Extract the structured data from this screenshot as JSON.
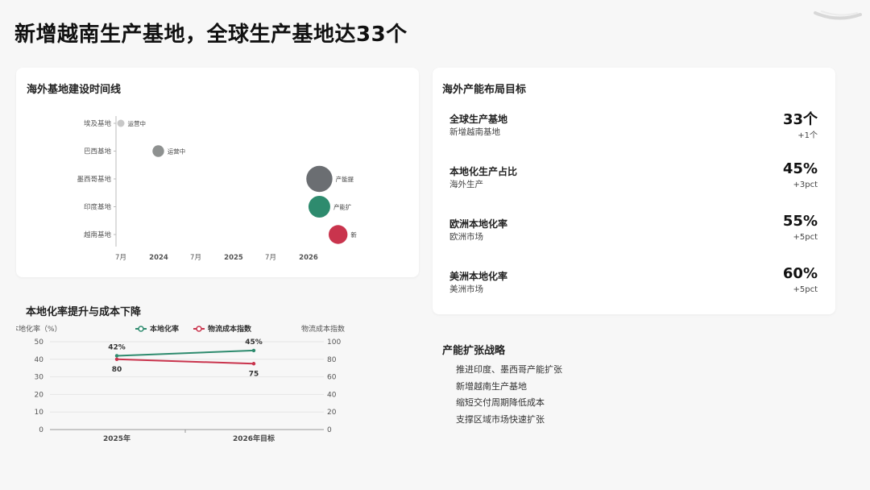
{
  "page": {
    "title": "新增越南生产基地，全球生产基地达33个"
  },
  "timeline": {
    "title": "海外基地建设时间线",
    "rows": [
      "埃及基地",
      "巴西基地",
      "墨西哥基地",
      "印度基地",
      "越南基地"
    ],
    "x_ticks": [
      "7月",
      "2024",
      "7月",
      "2025",
      "7月",
      "2026"
    ],
    "points": [
      {
        "row": 0,
        "t": 2023.5,
        "size": 1,
        "color": "#c8c8c8",
        "label": "运营中"
      },
      {
        "row": 1,
        "t": 2024.0,
        "size": 1.6,
        "color": "#8e9190",
        "label": "运营中"
      },
      {
        "row": 2,
        "t": 2026.15,
        "size": 3.6,
        "color": "#6b6e72",
        "label": "产能提"
      },
      {
        "row": 3,
        "t": 2026.15,
        "size": 3.0,
        "color": "#2e8b6e",
        "label": "产能扩"
      },
      {
        "row": 4,
        "t": 2026.4,
        "size": 2.6,
        "color": "#c9344d",
        "label": "新"
      }
    ]
  },
  "capacity": {
    "title": "海外产能布局目标",
    "metrics": [
      {
        "label": "全球生产基地",
        "sub": "新增越南基地",
        "value": "33个",
        "change": "+1个"
      },
      {
        "label": "本地化生产占比",
        "sub": "海外生产",
        "value": "45%",
        "change": "+3pct"
      },
      {
        "label": "欧洲本地化率",
        "sub": "欧洲市场",
        "value": "55%",
        "change": "+5pct"
      },
      {
        "label": "美洲本地化率",
        "sub": "美洲市场",
        "value": "60%",
        "change": "+5pct"
      }
    ]
  },
  "strategy": {
    "title": "产能扩张战略",
    "items": [
      "推进印度、墨西哥产能扩张",
      "新增越南生产基地",
      "缩短交付周期降低成本",
      "支撑区域市场快速扩张"
    ]
  },
  "line_chart": {
    "title": "本地化率提升与成本下降",
    "ylabel_left": "本地化率（%）",
    "ylabel_right": "物流成本指数"
  },
  "chart_data": {
    "type": "line",
    "categories": [
      "2025年",
      "2026年目标"
    ],
    "series": [
      {
        "name": "本地化率",
        "axis": "left",
        "values": [
          42,
          45
        ],
        "labels": [
          "42%",
          "45%"
        ],
        "color": "#2e8b6e"
      },
      {
        "name": "物流成本指数",
        "axis": "right",
        "values": [
          80,
          75
        ],
        "labels": [
          "80",
          "75"
        ],
        "color": "#c9344d"
      }
    ],
    "ylim_left": [
      0,
      50
    ],
    "yticks_left": [
      0,
      10,
      20,
      30,
      40,
      50
    ],
    "ylim_right": [
      0,
      100
    ],
    "yticks_right": [
      0,
      20,
      40,
      60,
      80,
      100
    ],
    "grid": true,
    "legend": "top"
  }
}
